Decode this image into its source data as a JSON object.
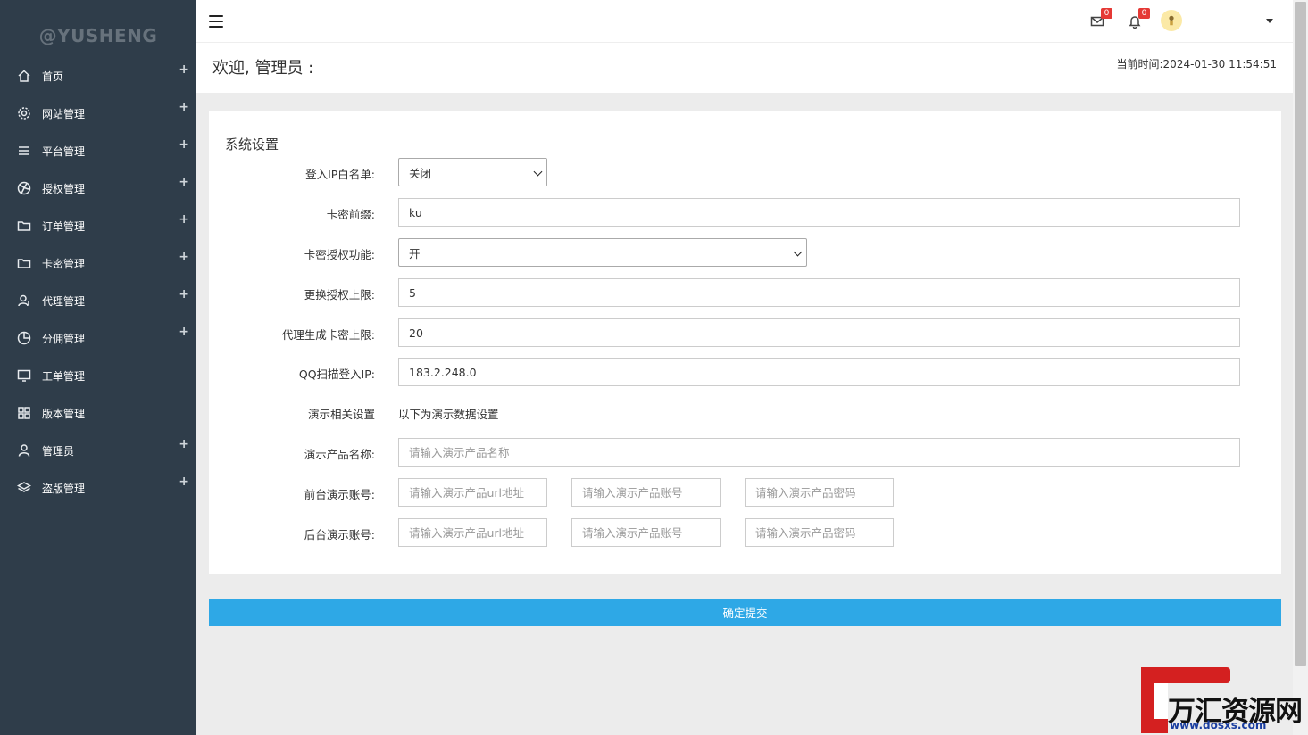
{
  "sidebar": {
    "brand": "@YUSHENG",
    "items": [
      {
        "label": "首页",
        "icon": "home-icon",
        "has_plus": true
      },
      {
        "label": "网站管理",
        "icon": "gear-icon",
        "has_plus": true
      },
      {
        "label": "平台管理",
        "icon": "menu-icon",
        "has_plus": true
      },
      {
        "label": "授权管理",
        "icon": "dribbble-icon",
        "has_plus": true
      },
      {
        "label": "订单管理",
        "icon": "folder-icon",
        "has_plus": true
      },
      {
        "label": "卡密管理",
        "icon": "folder-icon",
        "has_plus": true
      },
      {
        "label": "代理管理",
        "icon": "user-agent-icon",
        "has_plus": true
      },
      {
        "label": "分佣管理",
        "icon": "pie-icon",
        "has_plus": true
      },
      {
        "label": "工单管理",
        "icon": "monitor-icon",
        "has_plus": false
      },
      {
        "label": "版本管理",
        "icon": "grid-icon",
        "has_plus": false
      },
      {
        "label": "管理员",
        "icon": "user-icon",
        "has_plus": true
      },
      {
        "label": "盗版管理",
        "icon": "layers-icon",
        "has_plus": true
      }
    ],
    "plus_symbol": "+"
  },
  "topbar": {
    "mail_badge": "0",
    "bell_badge": "0"
  },
  "welcome": {
    "title": "欢迎, 管理员 :",
    "time": "当前时间:2024-01-30 11:54:51"
  },
  "form": {
    "title": "系统设置",
    "ip_whitelist": {
      "label": "登入IP白名单:",
      "value": "关闭"
    },
    "card_prefix": {
      "label": "卡密前缀:",
      "value": "ku"
    },
    "card_auth": {
      "label": "卡密授权功能:",
      "value": "开"
    },
    "change_limit": {
      "label": "更换授权上限:",
      "value": "5"
    },
    "agent_limit": {
      "label": "代理生成卡密上限:",
      "value": "20"
    },
    "qq_ip": {
      "label": "QQ扫描登入IP:",
      "value": "183.2.248.0"
    },
    "demo_settings": {
      "label": "演示相关设置",
      "value": "以下为演示数据设置"
    },
    "demo_name": {
      "label": "演示产品名称:",
      "placeholder": "请输入演示产品名称"
    },
    "front_demo": {
      "label": "前台演示账号:",
      "url_placeholder": "请输入演示产品url地址",
      "account_placeholder": "请输入演示产品账号",
      "password_placeholder": "请输入演示产品密码"
    },
    "back_demo": {
      "label": "后台演示账号:",
      "url_placeholder": "请输入演示产品url地址",
      "account_placeholder": "请输入演示产品账号",
      "password_placeholder": "请输入演示产品密码"
    },
    "submit_label": "确定提交"
  },
  "watermark": {
    "text": "万汇资源网",
    "url": "www.dosxs.com",
    "color": "#d42020"
  },
  "colors": {
    "sidebar_bg": "#2f3d4a",
    "accent": "#2ea8e6",
    "badge": "#e53935"
  }
}
